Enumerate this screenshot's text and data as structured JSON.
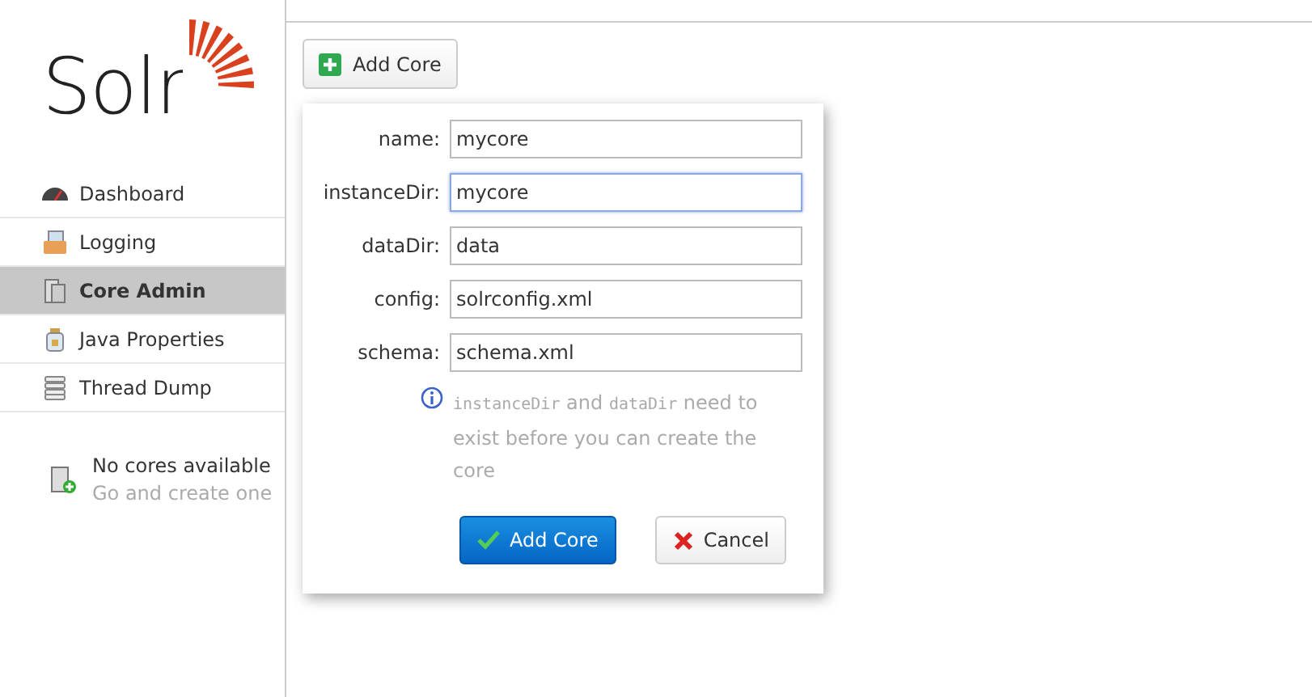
{
  "logo": {
    "text": "Solr"
  },
  "nav": [
    {
      "label": "Dashboard",
      "kind": "gauge",
      "selected": false
    },
    {
      "label": "Logging",
      "kind": "tray",
      "selected": false
    },
    {
      "label": "Core Admin",
      "kind": "servers",
      "selected": true
    },
    {
      "label": "Java Properties",
      "kind": "jar",
      "selected": false
    },
    {
      "label": "Thread Dump",
      "kind": "stack",
      "selected": false
    }
  ],
  "cores_notice": {
    "title": "No cores available",
    "link": "Go and create one"
  },
  "toolbar": {
    "add_button": "Add Core"
  },
  "dialog": {
    "fields": [
      {
        "label": "name:",
        "value": "mycore",
        "focused": false
      },
      {
        "label": "instanceDir:",
        "value": "mycore",
        "focused": true
      },
      {
        "label": "dataDir:",
        "value": "data",
        "focused": false
      },
      {
        "label": "config:",
        "value": "solrconfig.xml",
        "focused": false
      },
      {
        "label": "schema:",
        "value": "schema.xml",
        "focused": false
      }
    ],
    "hint": [
      {
        "text": "instanceDir",
        "kind": "code"
      },
      {
        "text": " and ",
        "kind": "plain"
      },
      {
        "text": "dataDir",
        "kind": "code"
      },
      {
        "text": " need to exist before you can create the core",
        "kind": "plain"
      }
    ],
    "submit": "Add Core",
    "cancel": "Cancel"
  }
}
